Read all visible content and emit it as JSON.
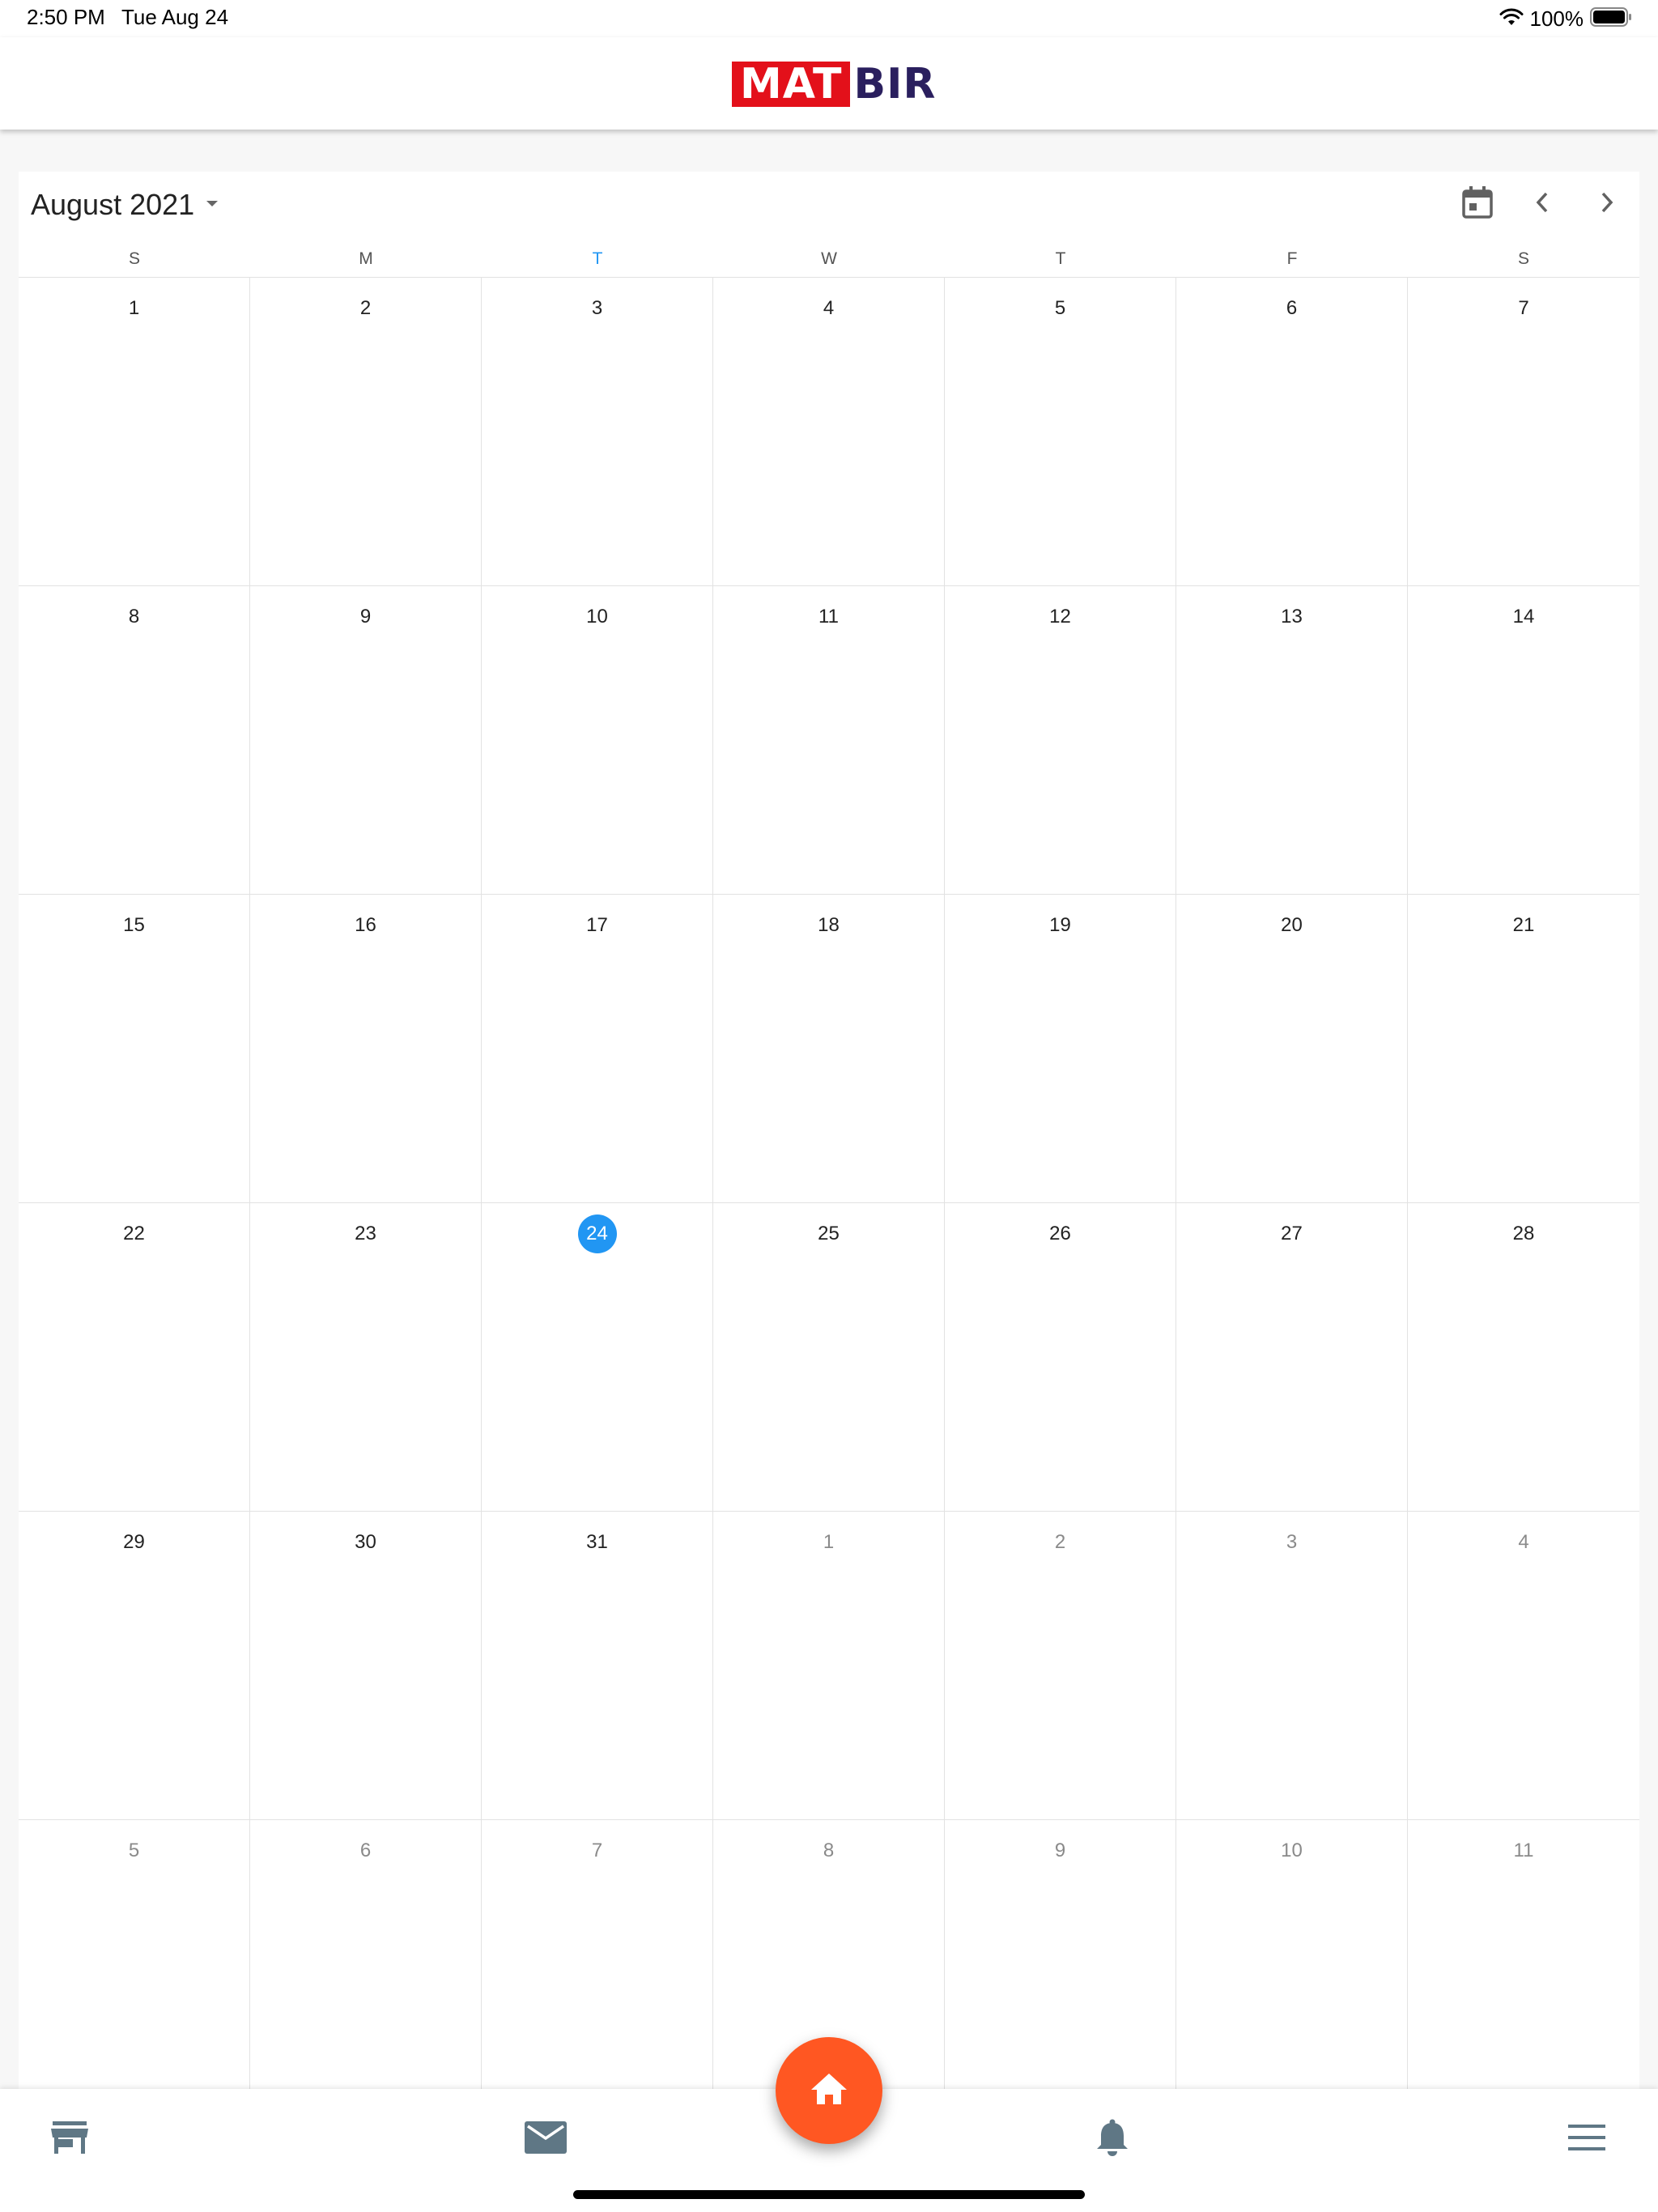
{
  "status_bar": {
    "time": "2:50 PM",
    "date": "Tue Aug 24",
    "battery": "100%"
  },
  "header": {
    "logo_part1": "MAT",
    "logo_part2": "BIR"
  },
  "calendar": {
    "title": "August 2021",
    "weekdays": [
      "S",
      "M",
      "T",
      "W",
      "T",
      "F",
      "S"
    ],
    "today_weekday_index": 2,
    "weeks": [
      [
        {
          "d": "1"
        },
        {
          "d": "2"
        },
        {
          "d": "3"
        },
        {
          "d": "4"
        },
        {
          "d": "5"
        },
        {
          "d": "6"
        },
        {
          "d": "7"
        }
      ],
      [
        {
          "d": "8"
        },
        {
          "d": "9"
        },
        {
          "d": "10"
        },
        {
          "d": "11"
        },
        {
          "d": "12"
        },
        {
          "d": "13"
        },
        {
          "d": "14"
        }
      ],
      [
        {
          "d": "15"
        },
        {
          "d": "16"
        },
        {
          "d": "17"
        },
        {
          "d": "18"
        },
        {
          "d": "19"
        },
        {
          "d": "20"
        },
        {
          "d": "21"
        }
      ],
      [
        {
          "d": "22"
        },
        {
          "d": "23"
        },
        {
          "d": "24",
          "today": true
        },
        {
          "d": "25"
        },
        {
          "d": "26"
        },
        {
          "d": "27"
        },
        {
          "d": "28"
        }
      ],
      [
        {
          "d": "29"
        },
        {
          "d": "30"
        },
        {
          "d": "31"
        },
        {
          "d": "1",
          "outside": true
        },
        {
          "d": "2",
          "outside": true
        },
        {
          "d": "3",
          "outside": true
        },
        {
          "d": "4",
          "outside": true
        }
      ],
      [
        {
          "d": "5",
          "outside": true
        },
        {
          "d": "6",
          "outside": true
        },
        {
          "d": "7",
          "outside": true
        },
        {
          "d": "8",
          "outside": true
        },
        {
          "d": "9",
          "outside": true
        },
        {
          "d": "10",
          "outside": true
        },
        {
          "d": "11",
          "outside": true
        }
      ]
    ]
  },
  "icons": {
    "dropdown": "caret-down-icon",
    "today": "calendar-today-icon",
    "prev": "chevron-left-icon",
    "next": "chevron-right-icon",
    "nav": [
      "store-icon",
      "mail-icon",
      "home-icon",
      "bell-icon",
      "menu-icon"
    ]
  },
  "colors": {
    "accent": "#2196f3",
    "fab": "#ff5722",
    "nav_icon": "#5f7785",
    "logo_red": "#e3101a",
    "logo_navy": "#2a1f5e"
  }
}
